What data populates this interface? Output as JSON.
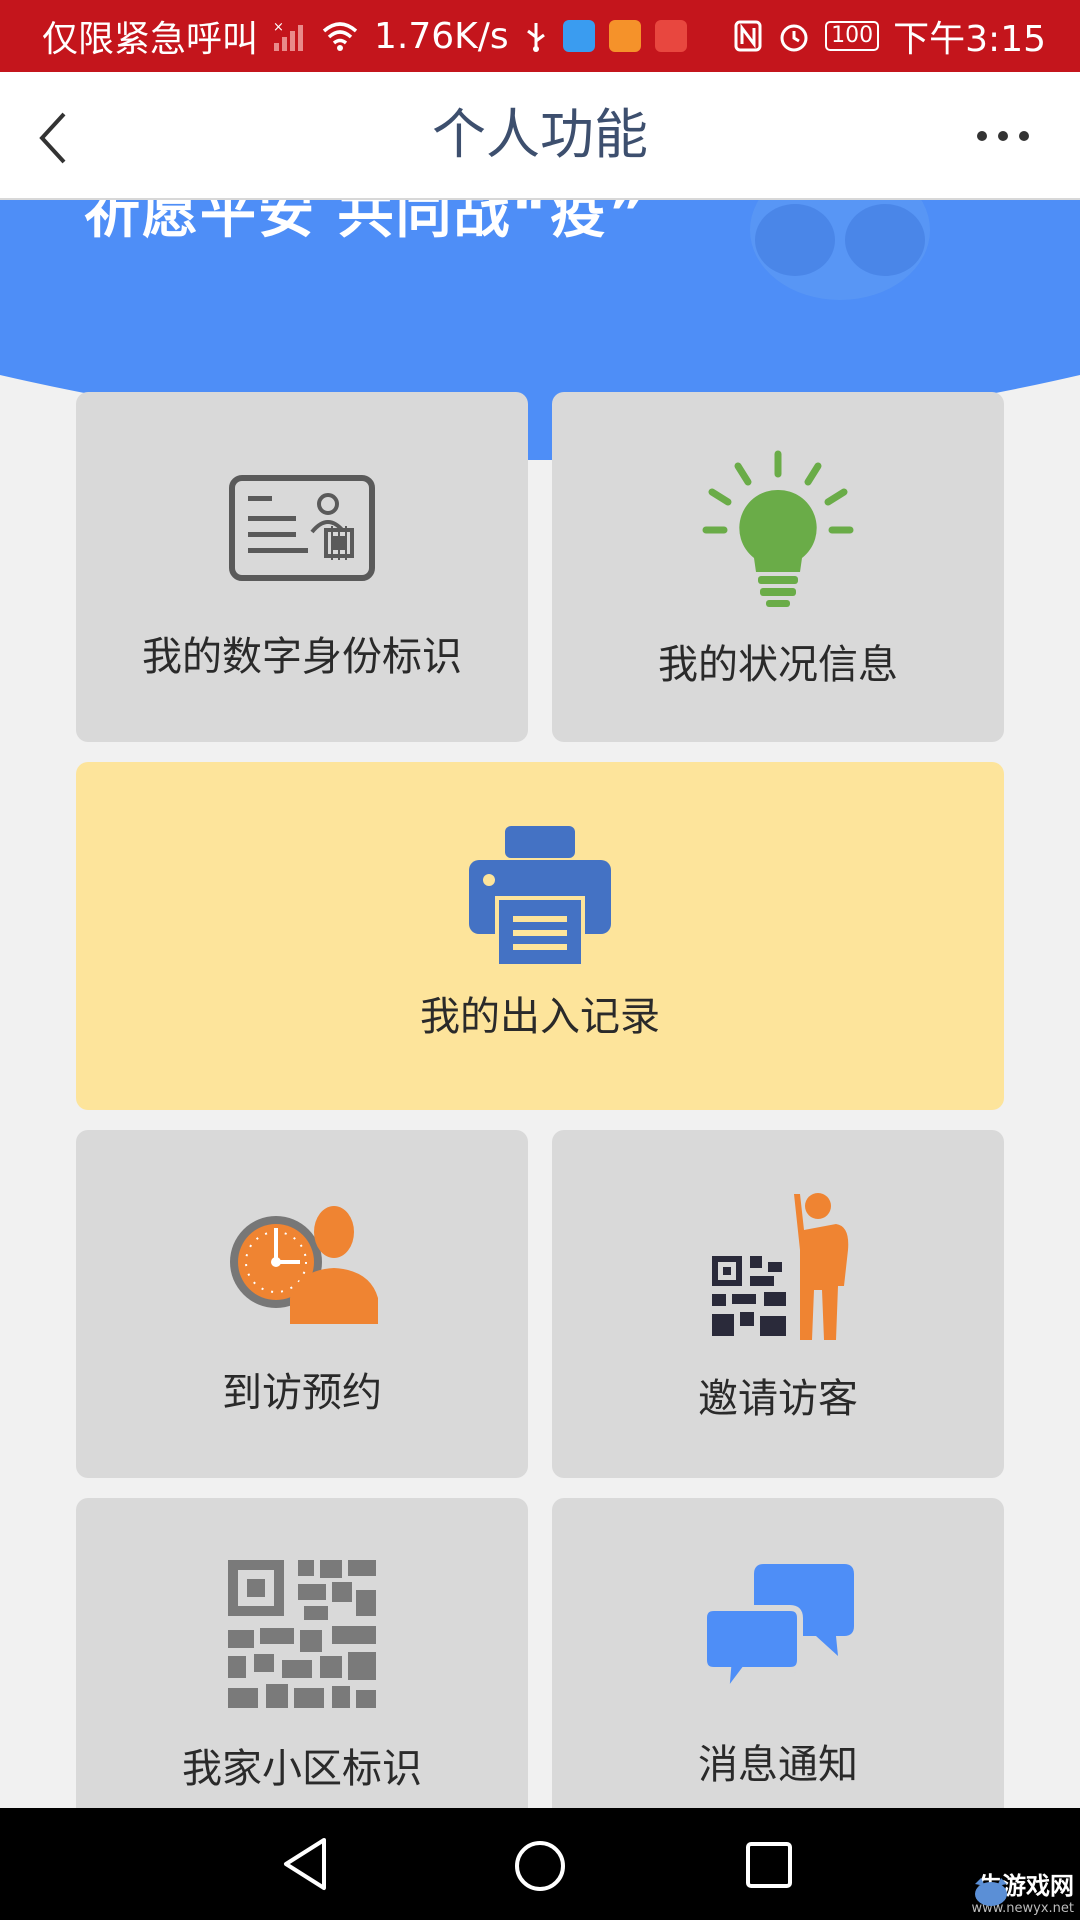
{
  "status_bar": {
    "carrier_text": "仅限紧急呼叫",
    "speed": "1.76K/s",
    "battery": "100",
    "time": "下午3:15"
  },
  "header": {
    "title": "个人功能"
  },
  "banner": {
    "text": "祈愿平安 共同战“疫”",
    "color": "#4e8ef7"
  },
  "tiles": [
    {
      "label": "我的数字身份标识",
      "icon": "id-card-icon"
    },
    {
      "label": "我的状况信息",
      "icon": "lightbulb-icon"
    },
    {
      "label": "我的出入记录",
      "icon": "printer-icon"
    },
    {
      "label": "到访预约",
      "icon": "clock-person-icon"
    },
    {
      "label": "邀请访客",
      "icon": "qr-person-icon"
    },
    {
      "label": "我家小区标识",
      "icon": "qr-code-icon"
    },
    {
      "label": "消息通知",
      "icon": "chat-bubbles-icon"
    }
  ],
  "watermark": {
    "main": "牛游戏网",
    "sub": "www.newyx.net"
  },
  "colors": {
    "status_bar": "#c4151c",
    "tile_gray": "#d9d9d9",
    "tile_yellow": "#fde49b",
    "accent_blue": "#4472c4",
    "green": "#6aac48",
    "orange": "#ef8432"
  }
}
